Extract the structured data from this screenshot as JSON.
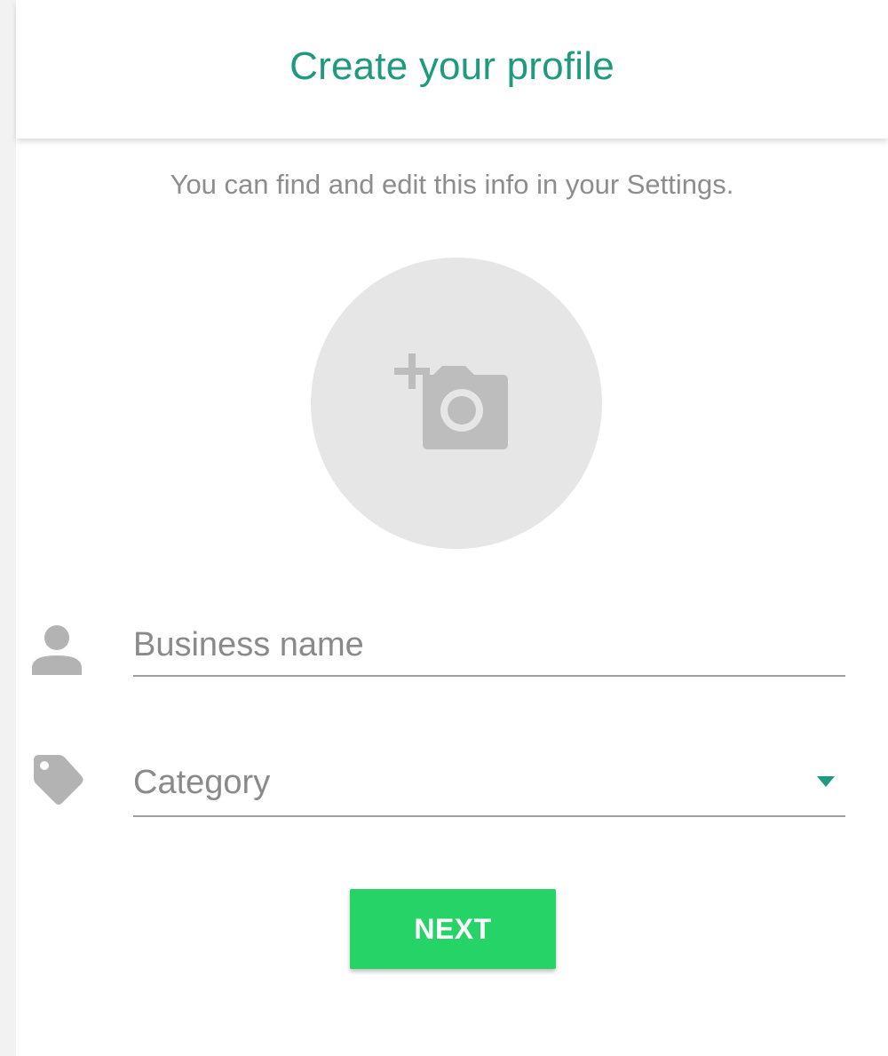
{
  "header": {
    "title": "Create your profile"
  },
  "subtitle": "You can find and edit this info in your Settings.",
  "profile_photo": {
    "icon": "add-photo-camera-icon"
  },
  "form": {
    "business_name": {
      "icon": "person-icon",
      "placeholder": "Business name",
      "value": ""
    },
    "category": {
      "icon": "tag-icon",
      "selected": "Category"
    }
  },
  "next_button": {
    "label": "NEXT"
  },
  "colors": {
    "title": "#1f9a7e",
    "button": "#25d366",
    "icon_gray": "#b3b3b3",
    "circle": "#e6e6e6"
  }
}
